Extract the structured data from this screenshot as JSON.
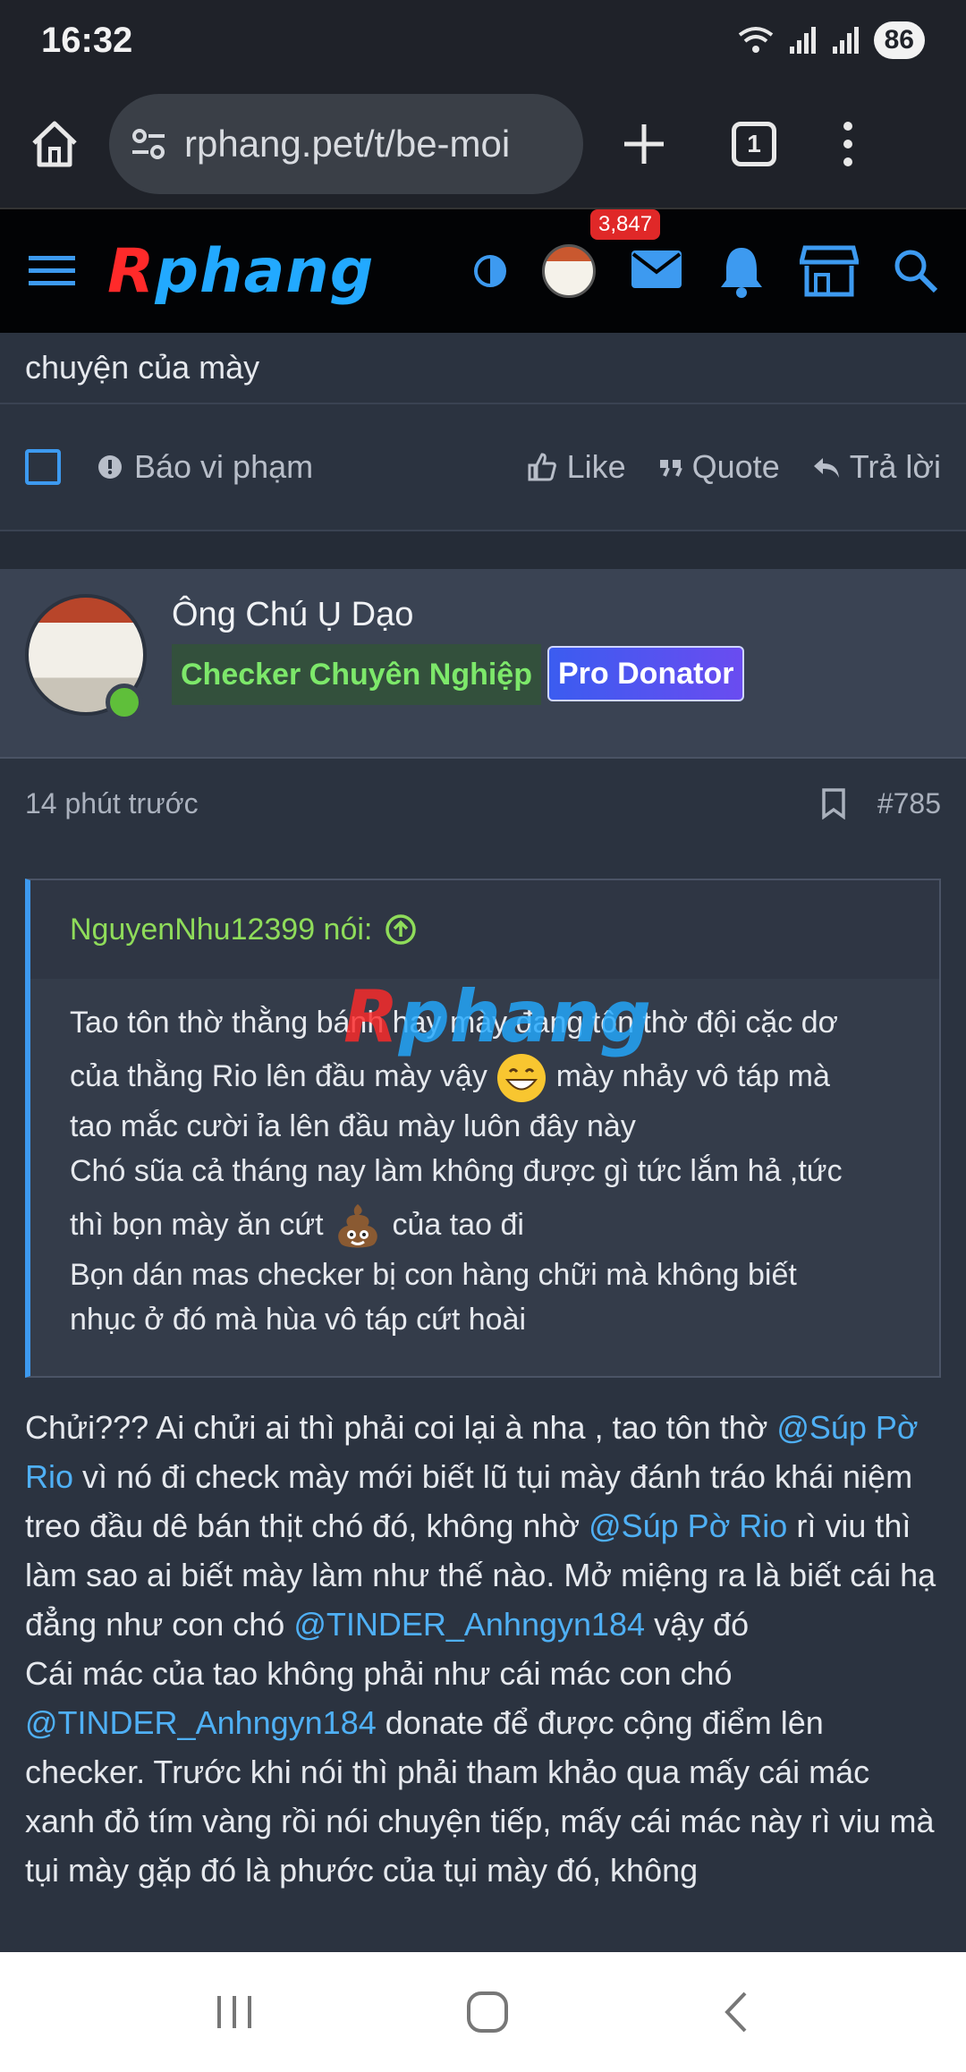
{
  "status_bar": {
    "time": "16:32",
    "battery": "86"
  },
  "browser": {
    "url": "rphang.pet/t/be-moi",
    "tab_count": "1"
  },
  "site": {
    "logo_first": "R",
    "logo_rest": "phang",
    "mail_count": "3,847"
  },
  "prev_post": {
    "trailing_text": "chuyện của mày",
    "report_label": "Báo vi phạm",
    "like_label": "Like",
    "quote_label": "Quote",
    "reply_label": "Trả lời"
  },
  "post": {
    "author": "Ông Chú Ụ Dạo",
    "tag_primary": "Checker Chuyên Nghiệp",
    "tag_secondary": "Pro Donator",
    "time": "14 phút trước",
    "number": "#785",
    "quote": {
      "author_line": "NguyenNhu12399 nói:",
      "line1": "Tao tôn thờ thằng bánh hay mày đang tôn thờ đội cặc dơ",
      "line2a": "của thằng Rio lên đầu mày vậy ",
      "line2b": " mày nhảy vô táp mà",
      "line3": "tao mắc cười ỉa lên đầu mày luôn đây này",
      "line4": "Chó sũa cả tháng nay làm không được gì tức lắm hả ,tức",
      "line5a": "thì bọn mày ăn cứt ",
      "line5b": " của tao đi",
      "line6": "Bọn dán mas checker bị con hàng chữi mà không biết",
      "line7": "nhục ở đó mà hùa vô táp cứt hoài"
    },
    "body": {
      "p1a": "Chửi??? Ai chửi ai thì phải coi lại à nha , tao tôn thờ ",
      "m1": "@Súp Pờ Rio",
      "p1b": " vì nó đi check mày mới biết lũ tụi mày đánh tráo khái niệm treo đầu dê bán thịt chó đó, không nhờ ",
      "m2": "@Súp Pờ Rio",
      "p1c": " rì viu thì làm sao ai biết mày làm như thế nào. Mở miệng ra là biết cái hạ đẳng như con chó ",
      "m3": "@TINDER_Anhngyn184",
      "p1d": " vậy đó",
      "p2a": "Cái mác của tao không phải như cái mác con chó ",
      "m4": "@TINDER_Anhngyn184",
      "p2b": " donate để được cộng điểm lên checker. Trước khi nói thì phải tham khảo qua mấy cái mác xanh đỏ tím vàng rồi nói chuyện tiếp, mấy cái mác này rì viu mà tụi mày gặp đó là phước của tụi mày đó, không"
    }
  },
  "watermark": {
    "first": "R",
    "rest": "phang"
  },
  "colors": {
    "accent": "#3d9af0",
    "mention": "#4fb0f5",
    "quote_author": "#8fdc5a",
    "badge": "#e02828"
  }
}
